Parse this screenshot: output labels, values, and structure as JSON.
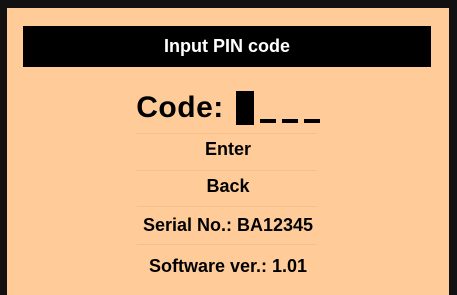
{
  "header": {
    "title": "Input PIN code"
  },
  "pin": {
    "label": "Code:",
    "length": 4,
    "cursor_position": 0
  },
  "menu": {
    "enter_label": "Enter",
    "back_label": "Back"
  },
  "info": {
    "serial": "Serial No.: BA12345",
    "software": "Software ver.: 1.01"
  },
  "colors": {
    "background": "#ffcc99",
    "title_bar": "#000000",
    "title_text": "#ffffff",
    "text": "#000000"
  }
}
